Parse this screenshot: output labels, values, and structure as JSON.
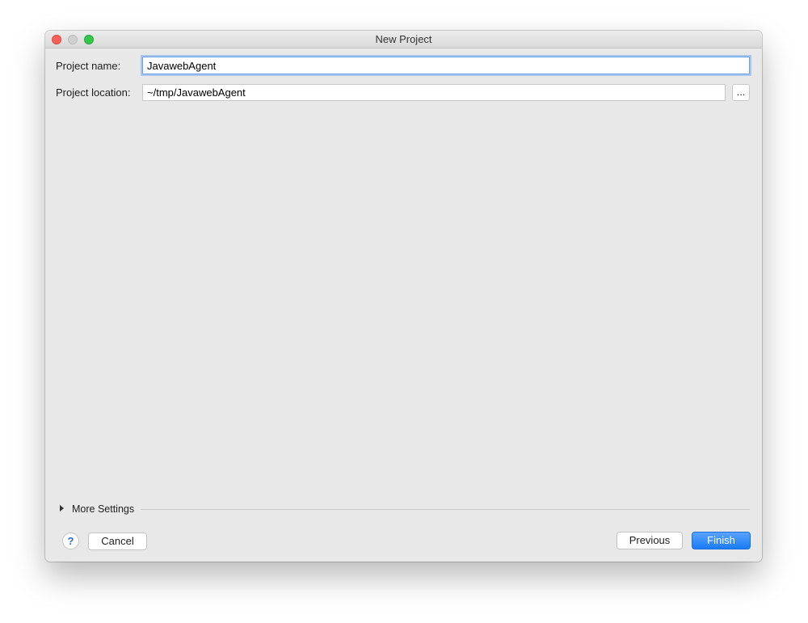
{
  "window": {
    "title": "New Project"
  },
  "form": {
    "project_name_label": "Project name:",
    "project_name_value": "JavawebAgent",
    "project_location_label": "Project location:",
    "project_location_value": "~/tmp/JavawebAgent",
    "browse_label": "..."
  },
  "more_settings": {
    "label": "More Settings",
    "expanded": false
  },
  "footer": {
    "help_label": "?",
    "cancel_label": "Cancel",
    "previous_label": "Previous",
    "finish_label": "Finish"
  },
  "colors": {
    "accent": "#1a7cf5",
    "focus_ring": "#a9c6ef",
    "close": "#fc5f57",
    "zoom": "#33c748"
  },
  "icons": {
    "disclosure": "triangle-right-icon",
    "help": "question-mark-icon"
  }
}
